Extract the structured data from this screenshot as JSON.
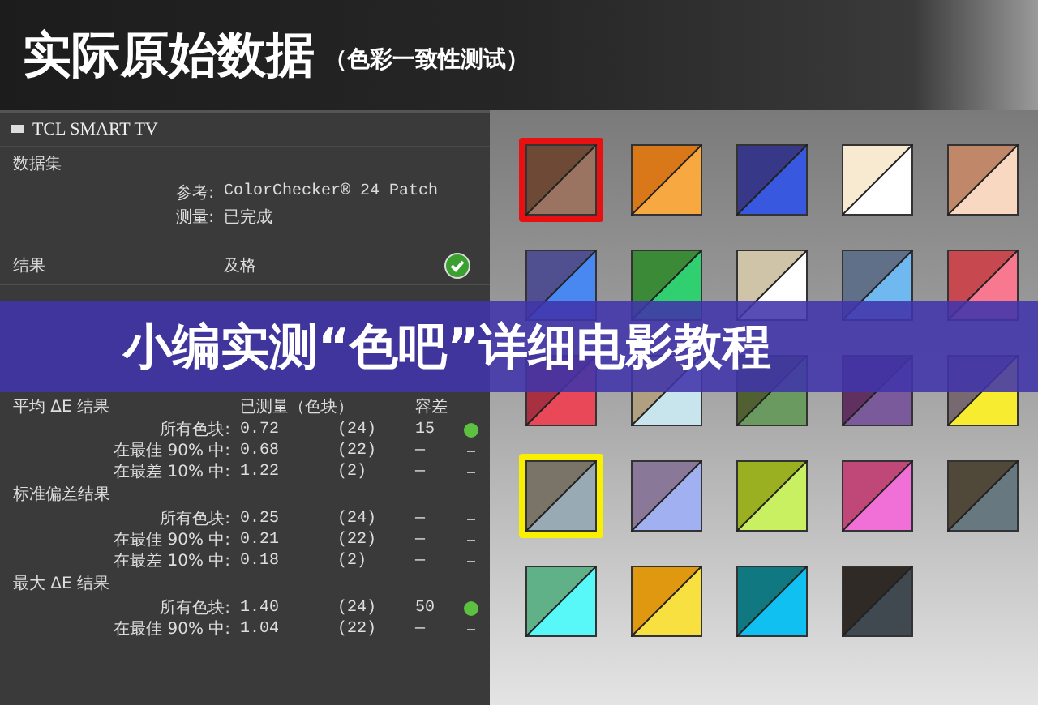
{
  "header": {
    "title": "实际原始数据",
    "subtitle": "（色彩一致性测试）"
  },
  "panel": {
    "title": "TCL SMART TV",
    "dataset": {
      "label": "数据集",
      "fields": [
        {
          "label": "参考:",
          "value": "ColorChecker® 24 Patch"
        },
        {
          "label": "测量:",
          "value": "已完成"
        }
      ]
    },
    "result": {
      "label": "结果",
      "value": "及格",
      "passed": true
    },
    "columns": [
      "已测量（色块）",
      "容差"
    ],
    "groups": [
      {
        "title": "平均 ΔE 结果",
        "rows": [
          {
            "label": "所有色块:",
            "value": "0.72",
            "count": "(24)",
            "tolerance": "15",
            "pass": true
          },
          {
            "label": "在最佳 90% 中:",
            "value": "0.68",
            "count": "(22)",
            "tolerance": "—",
            "pass": false
          },
          {
            "label": "在最差 10% 中:",
            "value": "1.22",
            "count": "(2)",
            "tolerance": "—",
            "pass": false
          }
        ]
      },
      {
        "title": "标准偏差结果",
        "rows": [
          {
            "label": "所有色块:",
            "value": "0.25",
            "count": "(24)",
            "tolerance": "—",
            "pass": false
          },
          {
            "label": "在最佳 90% 中:",
            "value": "0.21",
            "count": "(22)",
            "tolerance": "—",
            "pass": false
          },
          {
            "label": "在最差 10% 中:",
            "value": "0.18",
            "count": "(2)",
            "tolerance": "—",
            "pass": false
          }
        ]
      },
      {
        "title": "最大 ΔE 结果",
        "rows": [
          {
            "label": "所有色块:",
            "value": "1.40",
            "count": "(24)",
            "tolerance": "50",
            "pass": true
          },
          {
            "label": "在最佳 90% 中:",
            "value": "1.04",
            "count": "(22)",
            "tolerance": "—",
            "pass": false
          }
        ]
      }
    ]
  },
  "patches": [
    {
      "halves": [
        {
          "color": "#6e4a36"
        },
        {
          "color": "#9a7460"
        }
      ],
      "frame": {
        "color": "#e81010"
      }
    },
    {
      "halves": [
        {
          "color": "#d87818"
        },
        {
          "color": "#f8a840"
        }
      ]
    },
    {
      "halves": [
        {
          "color": "#383888"
        },
        {
          "color": "#3858e0"
        }
      ]
    },
    {
      "halves": [
        {
          "color": "#f8ead0"
        },
        {
          "color": "#ffffff"
        }
      ]
    },
    {
      "halves": [
        {
          "color": "#c08868"
        },
        {
          "color": "#f8d8c0"
        }
      ]
    },
    {
      "halves": [
        {
          "color": "#505090"
        },
        {
          "color": "#4888f0"
        }
      ]
    },
    {
      "halves": [
        {
          "color": "#3a8a38"
        },
        {
          "color": "#30d070"
        }
      ]
    },
    {
      "halves": [
        {
          "color": "#d0c4a8"
        },
        {
          "color": "#ffffff"
        }
      ]
    },
    {
      "halves": [
        {
          "color": "#607088"
        },
        {
          "color": "#70b8f0"
        }
      ]
    },
    {
      "halves": [
        {
          "color": "#c84850"
        },
        {
          "color": "#f87890"
        }
      ]
    },
    {
      "halves": [
        {
          "color": "#a83040"
        },
        {
          "color": "#e84858"
        }
      ]
    },
    {
      "halves": [
        {
          "color": "#b0a080"
        },
        {
          "color": "#c8e4ec"
        }
      ]
    },
    {
      "halves": [
        {
          "color": "#506030"
        },
        {
          "color": "#6a9a60"
        }
      ]
    },
    {
      "halves": [
        {
          "color": "#603060"
        },
        {
          "color": "#7a5a9a"
        }
      ]
    },
    {
      "halves": [
        {
          "color": "#786870"
        },
        {
          "color": "#f8ec30"
        }
      ]
    },
    {
      "halves": [
        {
          "color": "#7a7468"
        },
        {
          "color": "#98aab4"
        }
      ],
      "frame": {
        "color": "#f8f000"
      }
    },
    {
      "halves": [
        {
          "color": "#8a7898"
        },
        {
          "color": "#a0b0f0"
        }
      ]
    },
    {
      "halves": [
        {
          "color": "#9ab020"
        },
        {
          "color": "#c8f060"
        }
      ]
    },
    {
      "halves": [
        {
          "color": "#c04878"
        },
        {
          "color": "#f070d8"
        }
      ]
    },
    {
      "halves": [
        {
          "color": "#504838"
        },
        {
          "color": "#687880"
        }
      ]
    },
    {
      "halves": [
        {
          "color": "#60b088"
        },
        {
          "color": "#58f8f8"
        }
      ]
    },
    {
      "halves": [
        {
          "color": "#e09810"
        },
        {
          "color": "#f8e040"
        }
      ]
    },
    {
      "halves": [
        {
          "color": "#107880"
        },
        {
          "color": "#10c0f0"
        }
      ]
    },
    {
      "halves": [
        {
          "color": "#302a26"
        },
        {
          "color": "#404850"
        }
      ]
    }
  ],
  "banner": {
    "text": "小编实测“色吧”详细电影教程"
  }
}
